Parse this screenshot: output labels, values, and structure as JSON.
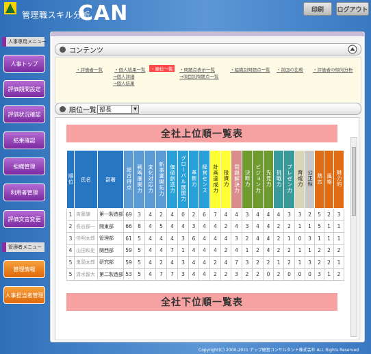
{
  "header": {
    "app_title": "管理職スキル分析",
    "brand": "CAN",
    "print_label": "印刷",
    "logout_label": "ログアウト"
  },
  "sidebar": {
    "section_hr": "人事専用メニュー",
    "hr_items": [
      "人事トップ",
      "評価期間設定",
      "評価状況確認",
      "結果確認",
      "組織管理",
      "利用者管理",
      "評価文言変更"
    ],
    "section_admin": "管理者メニュー",
    "admin_items": [
      "管理情報",
      "人事担当者管理"
    ]
  },
  "contents": {
    "title": "コンテンツ",
    "links": [
      "・評価者一覧",
      "・個人結果一覧",
      "→個人詳細",
      "→個人結果",
      "・順位一覧",
      "・問題点表示一覧",
      "→項目別問題点一覧",
      "・組織別問題点一覧",
      "・前回の比較",
      "・評価者の傾向分析"
    ]
  },
  "ranking": {
    "title": "順位一覧",
    "select_value": "部長",
    "top_banner": "全社上位順一覧表",
    "bottom_banner": "全社下位順一覧表",
    "headers": [
      "順位",
      "氏名",
      "部署",
      "総合得点",
      "戦略展開力",
      "変化対応力",
      "新事業開拓力",
      "価値創造力",
      "グローバル展開力",
      "革新力",
      "経営センス",
      "計画達成力",
      "投資力",
      "問題解決力",
      "決断力",
      "ビジョン力",
      "先見力",
      "挑戦力",
      "プレゼン力",
      "育成力",
      "公正性",
      "熱志",
      "風格",
      "魅力的"
    ],
    "rows": [
      [
        "1",
        "斉藤謙",
        "第一製造部",
        "69",
        "3",
        "4",
        "2",
        "4",
        "0",
        "2",
        "6",
        "7",
        "4",
        "4",
        "3",
        "4",
        "4",
        "4",
        "3",
        "3",
        "2",
        "5",
        "2",
        "3"
      ],
      [
        "2",
        "長谷部一",
        "開東部",
        "66",
        "8",
        "4",
        "5",
        "4",
        "4",
        "3",
        "4",
        "4",
        "2",
        "4",
        "3",
        "4",
        "4",
        "2",
        "2",
        "1",
        "1",
        "5",
        "1",
        "1"
      ],
      [
        "3",
        "佳明太郎",
        "管理部",
        "61",
        "5",
        "4",
        "4",
        "4",
        "3",
        "6",
        "4",
        "4",
        "4",
        "3",
        "2",
        "4",
        "4",
        "2",
        "1",
        "0",
        "3",
        "1",
        "1",
        "1"
      ],
      [
        "4",
        "山田和史",
        "関西部",
        "59",
        "5",
        "4",
        "4",
        "7",
        "1",
        "4",
        "4",
        "4",
        "2",
        "4",
        "1",
        "2",
        "4",
        "2",
        "2",
        "1",
        "1",
        "2",
        "2",
        "2"
      ],
      [
        "5",
        "鬼頭太郎",
        "研究部",
        "59",
        "5",
        "4",
        "2",
        "4",
        "3",
        "4",
        "4",
        "2",
        "4",
        "7",
        "3",
        "2",
        "2",
        "1",
        "2",
        "1",
        "3",
        "2",
        "2",
        "1"
      ],
      [
        "5",
        "清水智大",
        "第二製造部",
        "53",
        "5",
        "4",
        "7",
        "7",
        "3",
        "4",
        "4",
        "2",
        "2",
        "3",
        "2",
        "2",
        "0",
        "2",
        "0",
        "0",
        "0",
        "3",
        "1",
        "2"
      ]
    ]
  },
  "footer": {
    "copyright": "Copyright(C) 2000-2011 アップ経営コンサルタント株式会社 ALL Rights Reserved"
  }
}
